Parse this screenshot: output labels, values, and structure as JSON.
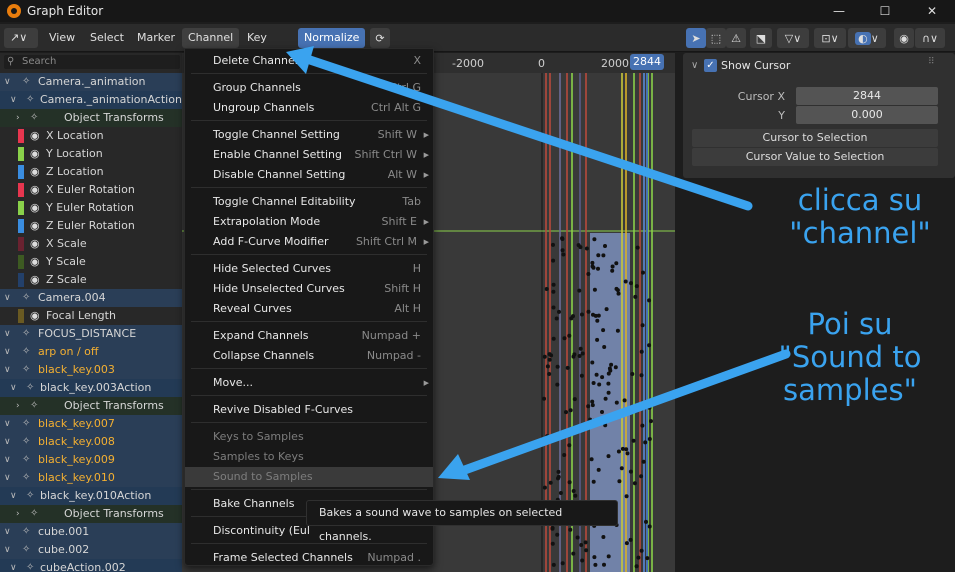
{
  "window": {
    "title": "Graph Editor",
    "minimize": "—",
    "maximize": "☐",
    "close": "✕"
  },
  "header": {
    "editor_type": "↗∨",
    "menus": [
      "View",
      "Select",
      "Marker",
      "Channel",
      "Key"
    ],
    "normalize_label": "Normalize"
  },
  "search": {
    "placeholder": "Search"
  },
  "channels": [
    {
      "label": "Camera._animation",
      "kind": "obj",
      "color": ""
    },
    {
      "label": "Camera._animationAction.",
      "kind": "act",
      "color": ""
    },
    {
      "label": "Object Transforms",
      "kind": "grp",
      "color": ""
    },
    {
      "label": "X Location",
      "kind": "ch",
      "color": "#e8364f"
    },
    {
      "label": "Y Location",
      "kind": "ch",
      "color": "#8ad14a"
    },
    {
      "label": "Z Location",
      "kind": "ch",
      "color": "#3a8de0"
    },
    {
      "label": "X Euler Rotation",
      "kind": "ch",
      "color": "#e8364f"
    },
    {
      "label": "Y Euler Rotation",
      "kind": "ch",
      "color": "#8ad14a"
    },
    {
      "label": "Z Euler Rotation",
      "kind": "ch",
      "color": "#3a8de0"
    },
    {
      "label": "X Scale",
      "kind": "ch",
      "color": "#6a2230"
    },
    {
      "label": "Y Scale",
      "kind": "ch",
      "color": "#3d5a22"
    },
    {
      "label": "Z Scale",
      "kind": "ch",
      "color": "#23406a"
    },
    {
      "label": "Camera.004",
      "kind": "obj",
      "color": ""
    },
    {
      "label": "Focal Length",
      "kind": "ch",
      "color": "#6a5a22"
    },
    {
      "label": "FOCUS_DISTANCE",
      "kind": "obj",
      "color": ""
    },
    {
      "label": "arp on / off",
      "kind": "obj",
      "color": ""
    },
    {
      "label": "black_key.003",
      "kind": "obj",
      "color": ""
    },
    {
      "label": "black_key.003Action",
      "kind": "act",
      "color": ""
    },
    {
      "label": "Object Transforms",
      "kind": "grp",
      "color": ""
    },
    {
      "label": "black_key.007",
      "kind": "obj",
      "color": ""
    },
    {
      "label": "black_key.008",
      "kind": "obj",
      "color": ""
    },
    {
      "label": "black_key.009",
      "kind": "obj",
      "color": ""
    },
    {
      "label": "black_key.010",
      "kind": "obj",
      "color": ""
    },
    {
      "label": "black_key.010Action",
      "kind": "act",
      "color": ""
    },
    {
      "label": "Object Transforms",
      "kind": "grp",
      "color": ""
    },
    {
      "label": "cube.001",
      "kind": "obj",
      "color": ""
    },
    {
      "label": "cube.002",
      "kind": "obj",
      "color": ""
    },
    {
      "label": "cubeAction.002",
      "kind": "act",
      "color": ""
    }
  ],
  "graph": {
    "ticks": [
      "-2000",
      "0",
      "2000"
    ],
    "current_frame": "2844"
  },
  "sidebar": {
    "show_cursor": "Show Cursor",
    "cursor_x_label": "Cursor X",
    "cursor_x_value": "2844",
    "y_label": "Y",
    "y_value": "0.000",
    "cursor_to_selection": "Cursor to Selection",
    "cursor_value_to_selection": "Cursor Value to Selection"
  },
  "menu": {
    "items": [
      {
        "label": "Delete Channels",
        "shortcut": "X",
        "disabled": false,
        "highlight": false
      },
      {
        "label": "Group Channels",
        "shortcut": "Ctrl G",
        "disabled": false,
        "highlight": false
      },
      {
        "label": "Ungroup Channels",
        "shortcut": "Ctrl Alt G",
        "disabled": false,
        "highlight": false
      },
      {
        "label": "Toggle Channel Setting",
        "shortcut": "Shift W",
        "disabled": false,
        "highlight": false
      },
      {
        "label": "Enable Channel Setting",
        "shortcut": "Shift Ctrl W",
        "disabled": false,
        "highlight": false
      },
      {
        "label": "Disable Channel Setting",
        "shortcut": "Alt W",
        "disabled": false,
        "highlight": false
      },
      {
        "label": "Toggle Channel Editability",
        "shortcut": "Tab",
        "disabled": false,
        "highlight": false
      },
      {
        "label": "Extrapolation Mode",
        "shortcut": "Shift E",
        "disabled": false,
        "highlight": false
      },
      {
        "label": "Add F-Curve Modifier",
        "shortcut": "Shift Ctrl M",
        "disabled": false,
        "highlight": false
      },
      {
        "label": "Hide Selected Curves",
        "shortcut": "H",
        "disabled": false,
        "highlight": false
      },
      {
        "label": "Hide Unselected Curves",
        "shortcut": "Shift H",
        "disabled": false,
        "highlight": false
      },
      {
        "label": "Reveal Curves",
        "shortcut": "Alt H",
        "disabled": false,
        "highlight": false
      },
      {
        "label": "Expand Channels",
        "shortcut": "Numpad +",
        "disabled": false,
        "highlight": false
      },
      {
        "label": "Collapse Channels",
        "shortcut": "Numpad -",
        "disabled": false,
        "highlight": false
      },
      {
        "label": "Move...",
        "shortcut": "",
        "disabled": false,
        "highlight": false
      },
      {
        "label": "Revive Disabled F-Curves",
        "shortcut": "",
        "disabled": false,
        "highlight": false
      },
      {
        "label": "Keys to Samples",
        "shortcut": "",
        "disabled": true,
        "highlight": false
      },
      {
        "label": "Samples to Keys",
        "shortcut": "",
        "disabled": true,
        "highlight": false
      },
      {
        "label": "Sound to Samples",
        "shortcut": "",
        "disabled": true,
        "highlight": true
      },
      {
        "label": "Bake Channels",
        "shortcut": "",
        "disabled": false,
        "highlight": false
      },
      {
        "label": "Discontinuity (Eul",
        "shortcut": "",
        "disabled": false,
        "highlight": false
      },
      {
        "label": "Frame Selected Channels",
        "shortcut": "Numpad .",
        "disabled": false,
        "highlight": false
      }
    ],
    "submenu_arrow": "▶"
  },
  "tooltip": {
    "text": "Bakes a sound wave to samples on selected channels."
  },
  "annotations": {
    "first": "clicca su\n\"channel\"",
    "second": "Poi su\n\"Sound to\nsamples\"",
    "color": "#3aa3ef"
  }
}
